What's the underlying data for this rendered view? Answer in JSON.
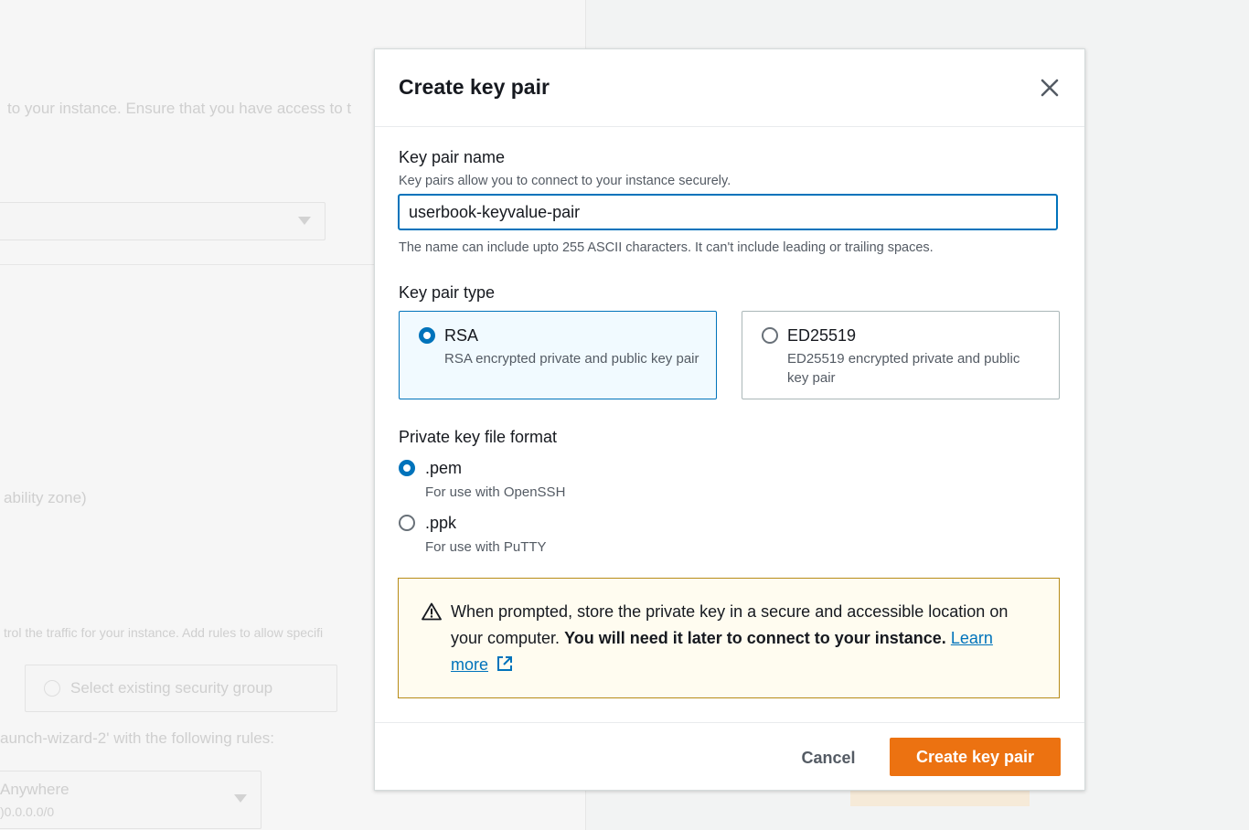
{
  "background": {
    "instance_text": "to your instance. Ensure that you have access to t",
    "zone_text": "ability zone)",
    "traffic_text": "trol the traffic for your instance. Add rules to allow specifi",
    "select_group": "Select existing security group",
    "wizard_text": "aunch-wizard-2' with the following rules:",
    "anywhere": "Anywhere",
    "cidr": ")0.0.0.0/0"
  },
  "modal": {
    "title": "Create key pair",
    "key_pair_name": {
      "label": "Key pair name",
      "description": "Key pairs allow you to connect to your instance securely.",
      "value": "userbook-keyvalue-pair",
      "constraint": "The name can include upto 255 ASCII characters. It can't include leading or trailing spaces."
    },
    "key_pair_type": {
      "label": "Key pair type",
      "options": [
        {
          "title": "RSA",
          "description": "RSA encrypted private and public key pair",
          "selected": true
        },
        {
          "title": "ED25519",
          "description": "ED25519 encrypted private and public key pair",
          "selected": false
        }
      ]
    },
    "file_format": {
      "label": "Private key file format",
      "options": [
        {
          "title": ".pem",
          "description": "For use with OpenSSH",
          "selected": true
        },
        {
          "title": ".ppk",
          "description": "For use with PuTTY",
          "selected": false
        }
      ]
    },
    "alert": {
      "text": "When prompted, store the private key in a secure and accessible location on your computer.",
      "bold": "You will need it later to connect to your instance.",
      "link_learn": "Learn",
      "link_more": "more"
    },
    "buttons": {
      "cancel": "Cancel",
      "create": "Create key pair"
    }
  },
  "colors": {
    "primary": "#ec7211",
    "link": "#0073bb",
    "alert_border": "#b78b17",
    "alert_bg": "#fffcf0"
  }
}
